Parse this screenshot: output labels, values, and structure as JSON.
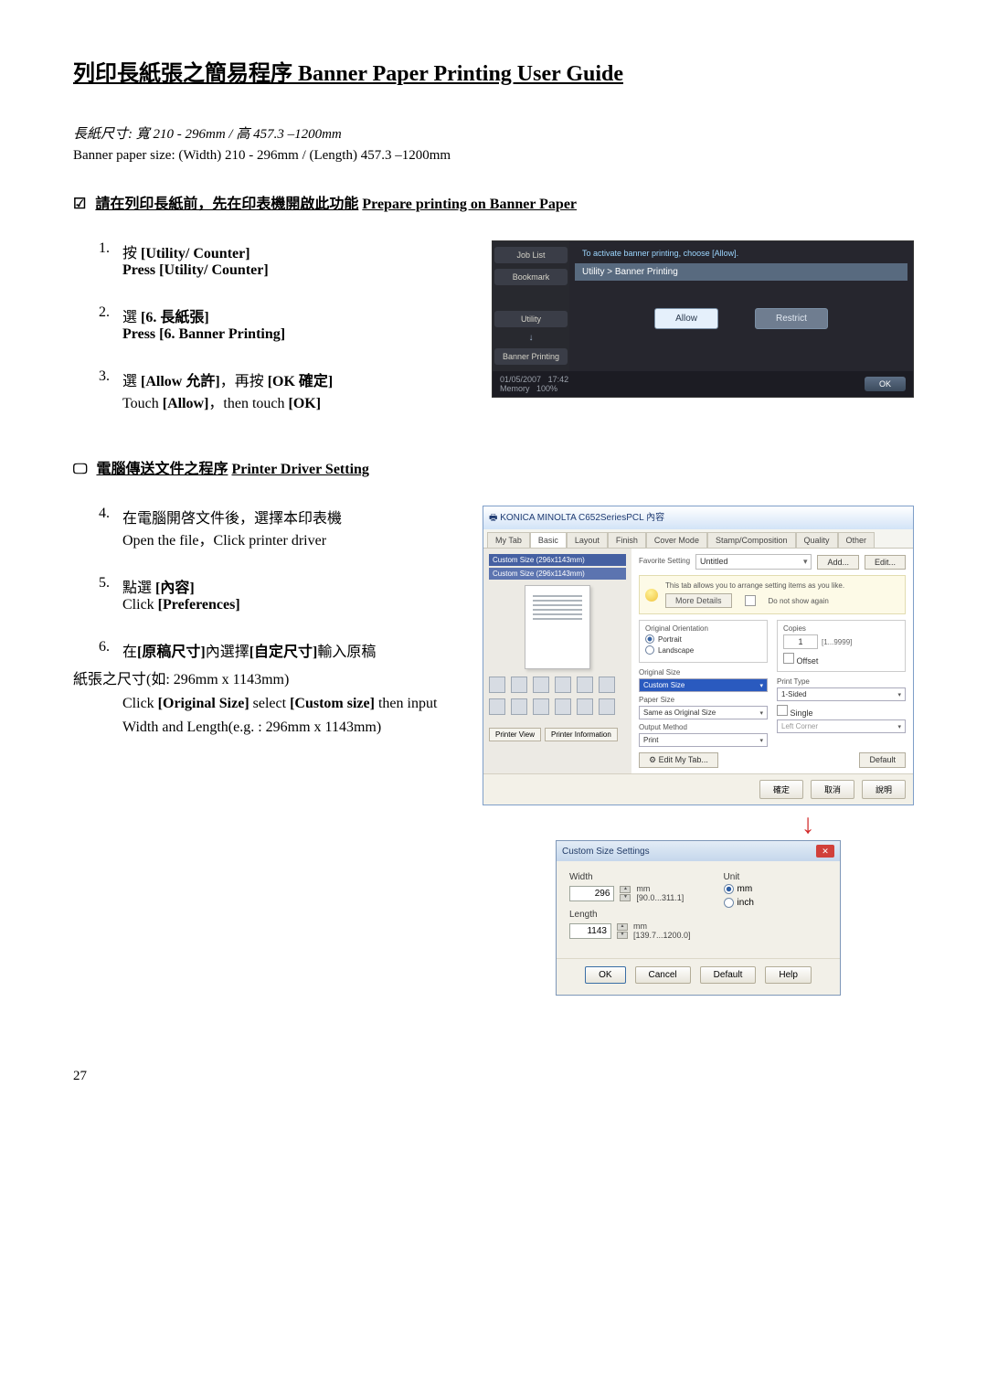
{
  "title": "列印長紙張之簡易程序 Banner Paper Printing User Guide",
  "size_note_zh": "長紙尺寸: 寬 210 - 296mm / 高 457.3 –1200mm",
  "size_note_en": "Banner paper size: (Width) 210 - 296mm / (Length) 457.3 –1200mm",
  "section1_icon": "☑",
  "section1_zh": "請在列印長紙前，先在印表機開啟此功能",
  "section1_en": " Prepare printing on Banner Paper",
  "steps1": {
    "s1_num": "1.",
    "s1_zh": "按 ",
    "s1_bold": "[Utility/ Counter]",
    "s1_en": "Press [Utility/ Counter]",
    "s2_num": "2.",
    "s2_zh": "選 ",
    "s2_bold": "[6. 長紙張]",
    "s2_en": "Press [6. Banner Printing]",
    "s3_num": "3.",
    "s3_zh_a": "選 ",
    "s3_bold_a": "[Allow 允許]",
    "s3_zh_b": "，再按 ",
    "s3_bold_b": "[OK 確定]",
    "s3_en_a": "Touch ",
    "s3_en_bold_a": "[Allow]",
    "s3_en_b": "，then touch ",
    "s3_en_bold_b": "[OK]"
  },
  "section2_icon": "🖵",
  "section2_zh": "電腦傳送文件之程序",
  "section2_en": " Printer Driver Setting",
  "steps2": {
    "s4_num": "4.",
    "s4_zh": "在電腦開啓文件後，選擇本印表機",
    "s4_en": "Open the file，Click printer driver",
    "s5_num": "5.",
    "s5_zh_a": "點選 ",
    "s5_bold": "[內容]",
    "s5_en_a": "Click ",
    "s5_en_bold": "[Preferences]",
    "s6_num": "6.",
    "s6_zh_a": "在",
    "s6_zh_b": "[原稿尺寸]",
    "s6_zh_c": "內選擇",
    "s6_zh_d": "[自定尺寸]",
    "s6_zh_e": "輸入原稿",
    "s6_zh_line2": "紙張之尺寸(如: 296mm x 1143mm)",
    "s6_en_a": "Click ",
    "s6_en_bold_a": "[Original Size]",
    "s6_en_b": " select ",
    "s6_en_bold_b": "[Custom size]",
    "s6_en_c": " then input",
    "s6_en_line2": "Width and Length(e.g. : 296mm x 1143mm)"
  },
  "printer_panel": {
    "job_list": "Job List",
    "bookmark": "Bookmark",
    "top_msg": "To activate banner printing, choose [Allow].",
    "breadcrumb": "Utility > Banner Printing",
    "side_utility": "Utility",
    "side_arrow": "↓",
    "side_banner": "Banner Printing",
    "allow": "Allow",
    "restrict": "Restrict",
    "date": "01/05/2007",
    "time": "17:42",
    "memory": "Memory",
    "mem_pct": "100%",
    "ok": "OK"
  },
  "driver": {
    "title": "KONICA MINOLTA C652SeriesPCL 內容",
    "tabs": [
      "My Tab",
      "Basic",
      "Layout",
      "Finish",
      "Cover Mode",
      "Stamp/Composition",
      "Quality",
      "Other"
    ],
    "active_tab": 1,
    "prev_label_a": "Custom Size (296x1143mm)",
    "prev_label_b": "Custom Size (296x1143mm)",
    "printer_view": "Printer View",
    "printer_info": "Printer Information",
    "fav_label": "Favorite Setting",
    "fav_value": "Untitled",
    "add": "Add...",
    "edit": "Edit...",
    "info_msg": "This tab allows you to arrange setting items as you like.",
    "more_details": "More Details",
    "dont_show": "Do not show again",
    "orig_orient": "Original Orientation",
    "portrait": "Portrait",
    "landscape": "Landscape",
    "copies": "Copies",
    "copies_val": "1",
    "copies_range": "[1...9999]",
    "offset": "Offset",
    "orig_size_lab": "Original Size",
    "orig_size_val": "Custom Size",
    "paper_size_lab": "Paper Size",
    "paper_size_val": "Same as Original Size",
    "print_type_lab": "Print Type",
    "print_type_val": "1-Sided",
    "output_lab": "Output Method",
    "output_val": "Print",
    "single_lab": "Single",
    "left_corner": "Left Corner",
    "edit_my_tab": "Edit My Tab...",
    "default": "Default",
    "f_ok": "確定",
    "f_cancel": "取消",
    "f_help": "說明"
  },
  "csd": {
    "title": "Custom Size Settings",
    "width_lab": "Width",
    "width_val": "296",
    "width_unit": "mm [90.0...311.1]",
    "length_lab": "Length",
    "length_val": "1143",
    "length_unit": "mm [139.7...1200.0]",
    "unit_lab": "Unit",
    "mm": "mm",
    "inch": "inch",
    "ok": "OK",
    "cancel": "Cancel",
    "default": "Default",
    "help": "Help"
  },
  "page_num": "27"
}
